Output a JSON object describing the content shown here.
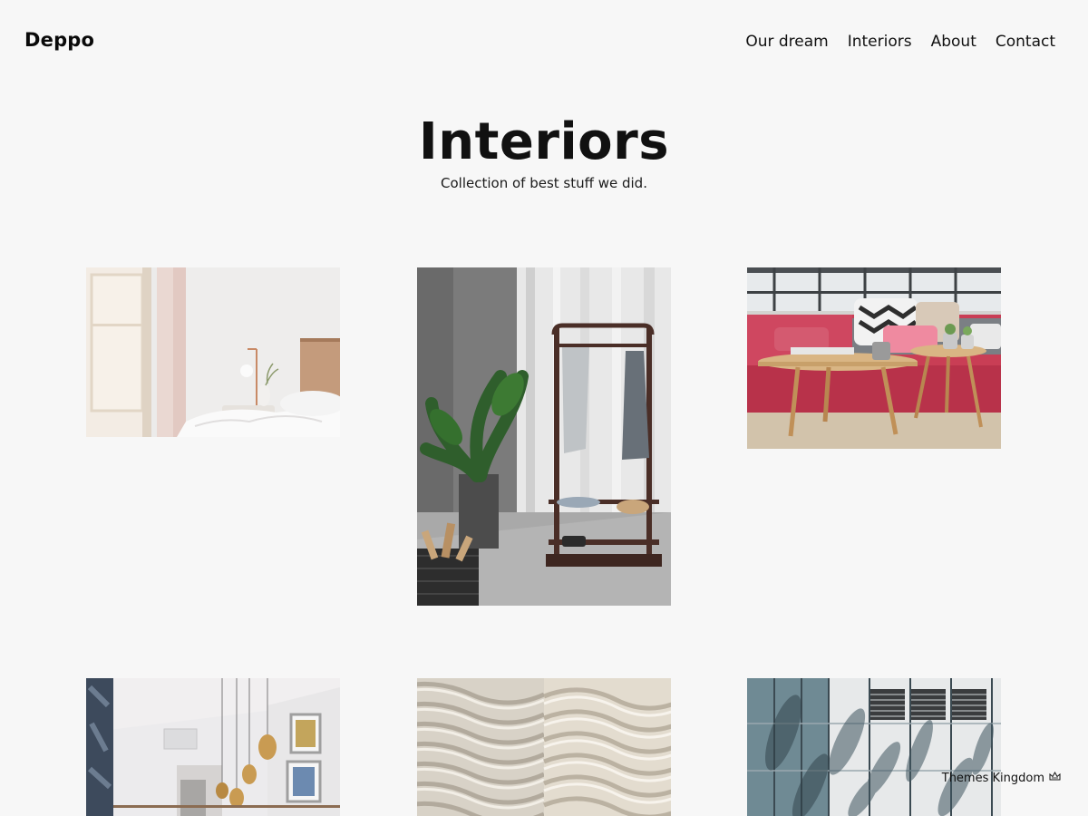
{
  "header": {
    "logo": "Deppo",
    "nav": [
      "Our dream",
      "Interiors",
      "About",
      "Contact"
    ]
  },
  "hero": {
    "title": "Interiors",
    "subtitle": "Collection of best stuff we did."
  },
  "gallery": [
    {
      "subject": "bedroom-with-lamp-photo"
    },
    {
      "subject": "clothes-rack-with-plant-photo"
    },
    {
      "subject": "pink-sofa-with-tables-photo"
    },
    {
      "subject": "hallway-with-pendant-lights-photo"
    },
    {
      "subject": "wavy-wall-texture-photo"
    },
    {
      "subject": "building-facade-with-shadows-photo"
    }
  ],
  "footer_badge": {
    "label": "Themes Kingdom",
    "icon": "crown-icon"
  },
  "colors": {
    "background": "#f7f7f7",
    "text": "#111111"
  }
}
